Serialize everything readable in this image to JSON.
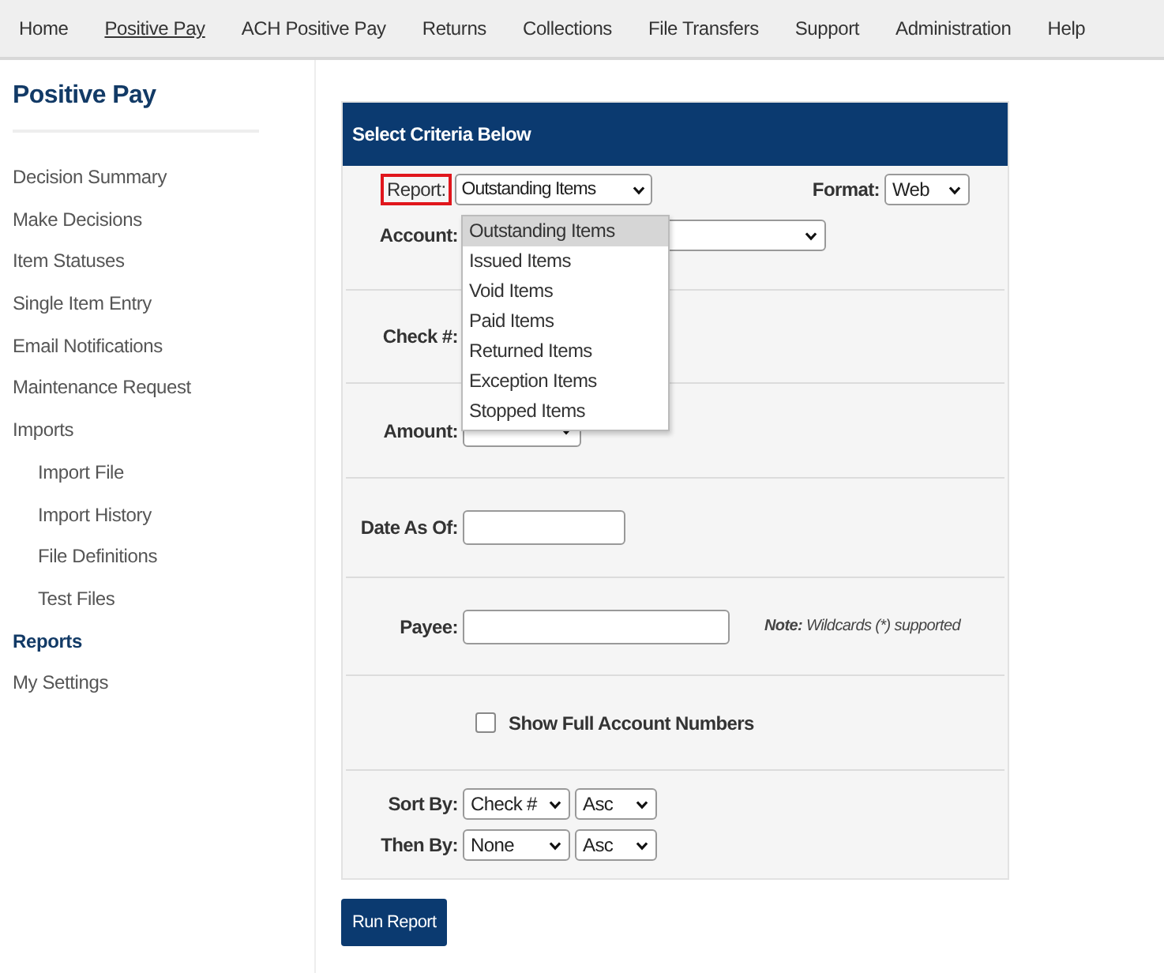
{
  "nav": [
    {
      "label": "Home",
      "selected": false
    },
    {
      "label": "Positive Pay",
      "selected": true
    },
    {
      "label": "ACH Positive Pay",
      "selected": false
    },
    {
      "label": "Returns",
      "selected": false
    },
    {
      "label": "Collections",
      "selected": false
    },
    {
      "label": "File Transfers",
      "selected": false
    },
    {
      "label": "Support",
      "selected": false
    },
    {
      "label": "Administration",
      "selected": false
    },
    {
      "label": "Help",
      "selected": false
    }
  ],
  "sidebar": {
    "title": "Positive Pay",
    "items": [
      {
        "label": "Decision Summary",
        "selected": false
      },
      {
        "label": "Make Decisions",
        "selected": false
      },
      {
        "label": "Item Statuses",
        "selected": false
      },
      {
        "label": "Single Item Entry",
        "selected": false
      },
      {
        "label": "Email Notifications",
        "selected": false
      },
      {
        "label": "Maintenance Request",
        "selected": false
      },
      {
        "label": "Imports",
        "selected": false,
        "children": [
          {
            "label": "Import File",
            "selected": false
          },
          {
            "label": "Import History",
            "selected": false
          },
          {
            "label": "File Definitions",
            "selected": false
          },
          {
            "label": "Test Files",
            "selected": false
          }
        ]
      },
      {
        "label": "Reports",
        "selected": true
      },
      {
        "label": "My Settings",
        "selected": false
      }
    ]
  },
  "form": {
    "title": "Select Criteria Below",
    "report": {
      "label": "Report:",
      "value": "Outstanding Items",
      "highlighted": true,
      "expanded": true,
      "options": [
        {
          "label": "Outstanding Items",
          "selected": true
        },
        {
          "label": "Issued Items",
          "selected": false
        },
        {
          "label": "Void Items",
          "selected": false
        },
        {
          "label": "Paid Items",
          "selected": false
        },
        {
          "label": "Returned Items",
          "selected": false
        },
        {
          "label": "Exception Items",
          "selected": false
        },
        {
          "label": "Stopped Items",
          "selected": false
        }
      ]
    },
    "format": {
      "label": "Format:",
      "value": "Web"
    },
    "account": {
      "label": "Account:"
    },
    "check": {
      "label": "Check #:"
    },
    "amount": {
      "label": "Amount:"
    },
    "date": {
      "label": "Date As Of:"
    },
    "payee": {
      "label": "Payee:"
    },
    "note": "**Note:** Wildcards (*) supported",
    "full_numbers": {
      "label": "Show Full Account Numbers",
      "checked": false
    },
    "sort": [
      {
        "label": "Sort By:",
        "field": "Check #",
        "order": "Asc"
      },
      {
        "label": "Then By:",
        "field": "None",
        "order": "Asc"
      }
    ],
    "button": "Run Report"
  }
}
